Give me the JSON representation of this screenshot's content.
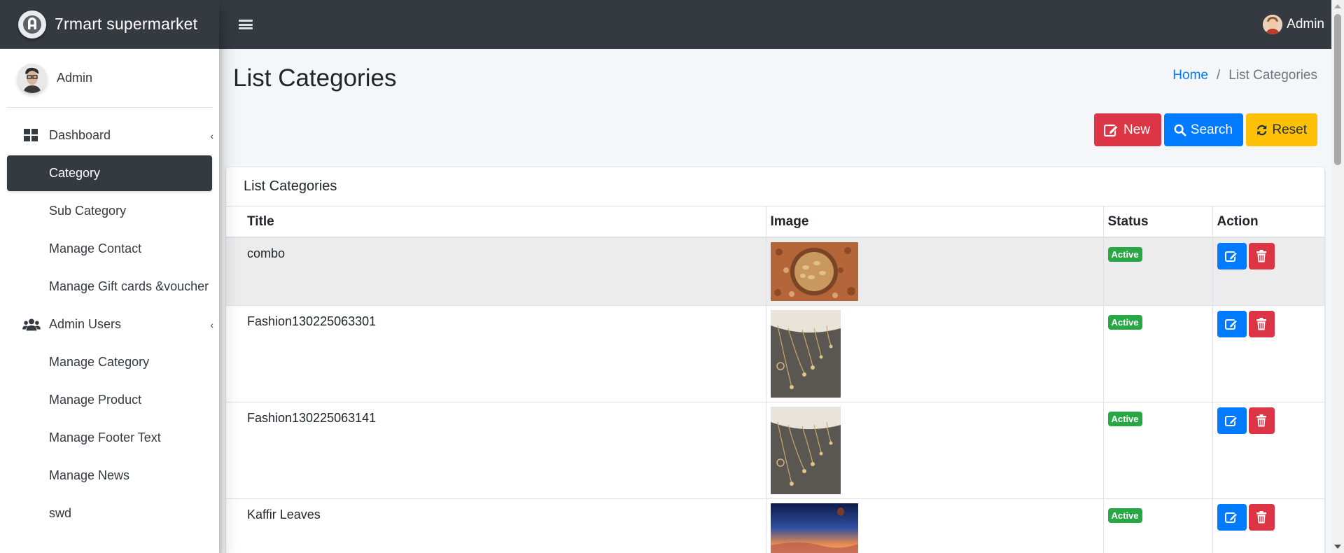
{
  "brand": {
    "name": "7rmart supermarket",
    "logo_icon": "brand-logo-icon"
  },
  "sidebar": {
    "user_name": "Admin",
    "items": [
      {
        "label": "Dashboard",
        "icon": "dashboard-icon",
        "caret": "‹"
      },
      {
        "label": "Category",
        "active": true
      },
      {
        "label": "Sub Category"
      },
      {
        "label": "Manage Contact"
      },
      {
        "label": "Manage Gift cards &voucher"
      },
      {
        "label": "Admin Users",
        "icon": "users-icon",
        "caret": "‹"
      },
      {
        "label": "Manage Category"
      },
      {
        "label": "Manage Product"
      },
      {
        "label": "Manage Footer Text"
      },
      {
        "label": "Manage News"
      },
      {
        "label": "swd"
      }
    ]
  },
  "topbar": {
    "user_name": "Admin"
  },
  "page": {
    "title": "List Categories",
    "breadcrumb": {
      "home": "Home",
      "current": "List Categories",
      "separator": "/"
    }
  },
  "actions": {
    "new": "New",
    "search": "Search",
    "reset": "Reset"
  },
  "card": {
    "title": "List Categories"
  },
  "table": {
    "columns": [
      "Title",
      "Image",
      "Status",
      "Action"
    ],
    "rows": [
      {
        "title": "combo",
        "image": "nuts-bowl-image",
        "status": "Active"
      },
      {
        "title": "Fashion130225063301",
        "image": "necklaces-image",
        "status": "Active"
      },
      {
        "title": "Fashion130225063141",
        "image": "necklaces-image",
        "status": "Active"
      },
      {
        "title": "Kaffir Leaves",
        "image": "sunset-balloon-image",
        "status": "Active"
      }
    ]
  },
  "colors": {
    "navbar": "#343a40",
    "primary": "#007bff",
    "danger": "#dc3545",
    "warning": "#ffc107",
    "success": "#28a745",
    "content_bg": "#f4f6f9"
  }
}
